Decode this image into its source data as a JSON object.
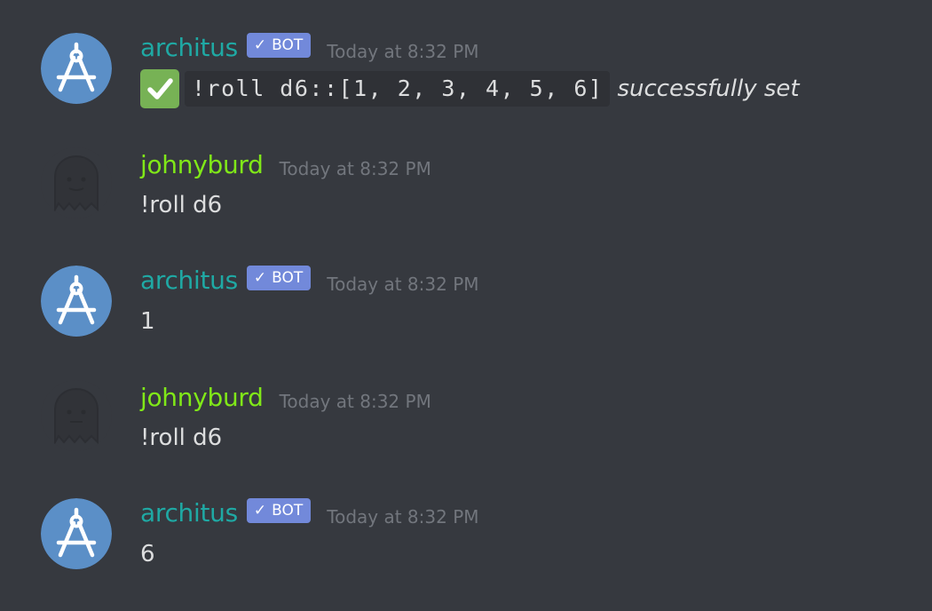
{
  "messages": [
    {
      "author": "architus",
      "is_bot": true,
      "bot_tag": "BOT",
      "timestamp": "Today at 8:32 PM",
      "avatar_icon": "compass-icon",
      "content": {
        "emoji": "white-check-mark",
        "code": "!roll d6::[1, 2, 3, 4, 5, 6]",
        "text": "successfully set"
      }
    },
    {
      "author": "johnyburd",
      "is_bot": false,
      "timestamp": "Today at 8:32 PM",
      "avatar_icon": "ghost-icon",
      "content": {
        "text": "!roll d6"
      }
    },
    {
      "author": "architus",
      "is_bot": true,
      "bot_tag": "BOT",
      "timestamp": "Today at 8:32 PM",
      "avatar_icon": "compass-icon",
      "content": {
        "text": "1"
      }
    },
    {
      "author": "johnyburd",
      "is_bot": false,
      "timestamp": "Today at 8:32 PM",
      "avatar_icon": "ghost-icon",
      "content": {
        "text": "!roll d6"
      }
    },
    {
      "author": "architus",
      "is_bot": true,
      "bot_tag": "BOT",
      "timestamp": "Today at 8:32 PM",
      "avatar_icon": "compass-icon",
      "content": {
        "text": "6"
      }
    }
  ],
  "colors": {
    "background": "#36393f",
    "bot_username": "#1fa9a4",
    "user_username": "#80e818",
    "bot_tag": "#7289da",
    "timestamp": "#72767d",
    "message_text": "#dcddde",
    "code_background": "#2f3136",
    "check_emoji": "#77b255",
    "bot_avatar": "#5b8fc7"
  }
}
